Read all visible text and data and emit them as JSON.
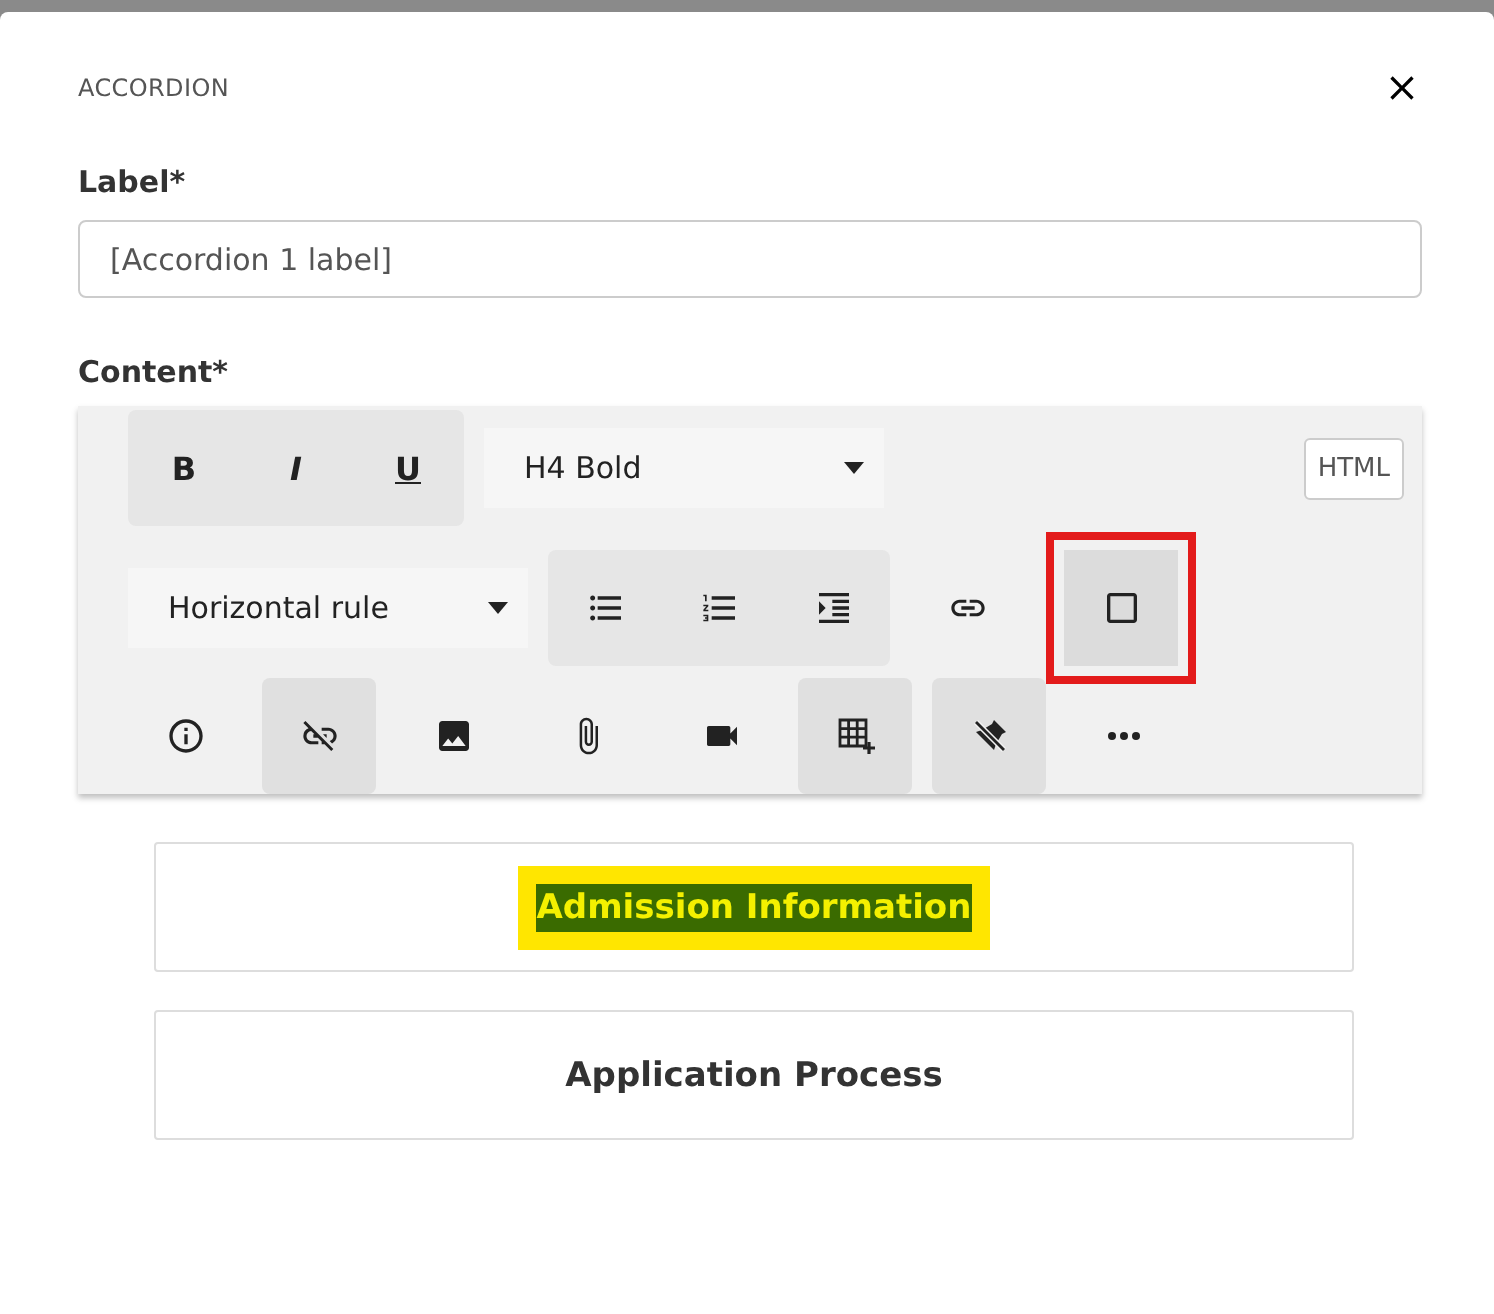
{
  "dialog": {
    "title": "ACCORDION"
  },
  "label_field": {
    "label": "Label*",
    "value": "[Accordion 1 label]"
  },
  "content_label": "Content*",
  "toolbar": {
    "rows": [
      [
        {
          "kind": "group",
          "buttons": [
            {
              "kind": "bold",
              "text": "B"
            },
            {
              "kind": "italic",
              "text": "I"
            },
            {
              "kind": "underline",
              "text": "U"
            }
          ]
        },
        {
          "kind": "dropdown",
          "value": "H4 Bold"
        },
        {
          "kind": "html",
          "text": "HTML"
        }
      ],
      [
        {
          "kind": "dropdown",
          "value": "Horizontal rule"
        },
        {
          "kind": "group",
          "buttons": [
            {
              "kind": "bulleted-list"
            },
            {
              "kind": "numbered-list"
            },
            {
              "kind": "indent"
            }
          ]
        },
        {
          "kind": "link",
          "active": false
        },
        {
          "kind": "square",
          "active": true,
          "annotated": true
        }
      ],
      [
        {
          "kind": "info",
          "active": false
        },
        {
          "kind": "unlink",
          "active": true
        },
        {
          "kind": "image",
          "active": false
        },
        {
          "kind": "attachment",
          "active": false
        },
        {
          "kind": "video",
          "active": false
        },
        {
          "kind": "table",
          "active": true
        },
        {
          "kind": "clear-format",
          "active": true
        },
        {
          "kind": "more",
          "active": false
        }
      ]
    ]
  },
  "accordion_items": [
    {
      "label": "Admission Information",
      "highlighted": true
    },
    {
      "label": "Application Process",
      "highlighted": false
    }
  ]
}
